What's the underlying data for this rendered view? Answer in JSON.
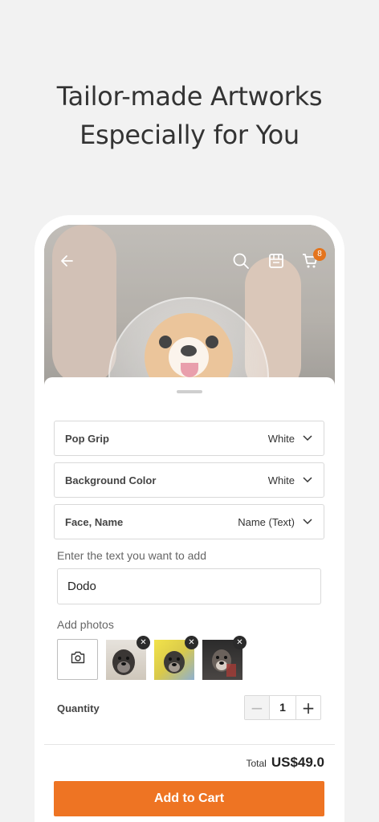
{
  "headline": {
    "line1": "Tailor-made Artworks",
    "line2": "Especially for You"
  },
  "topbar": {
    "back_icon": "arrow-left-icon",
    "search_icon": "search-icon",
    "store_icon": "store-icon",
    "cart_icon": "cart-icon",
    "cart_count": "8"
  },
  "options": [
    {
      "label": "Pop Grip",
      "value": "White"
    },
    {
      "label": "Background Color",
      "value": "White"
    },
    {
      "label": "Face, Name",
      "value": "Name (Text)"
    }
  ],
  "text_entry": {
    "label": "Enter the text you want to add",
    "value": "Dodo"
  },
  "photos": {
    "label": "Add photos",
    "add_icon": "camera-icon",
    "remove_glyph": "✕"
  },
  "quantity": {
    "label": "Quantity",
    "value": "1",
    "minus": "−",
    "plus": "+"
  },
  "footer": {
    "total_label": "Total",
    "total_value": "US$49.0",
    "cart_button": "Add to Cart"
  },
  "colors": {
    "accent": "#ee7423",
    "badge": "#e4741c"
  }
}
